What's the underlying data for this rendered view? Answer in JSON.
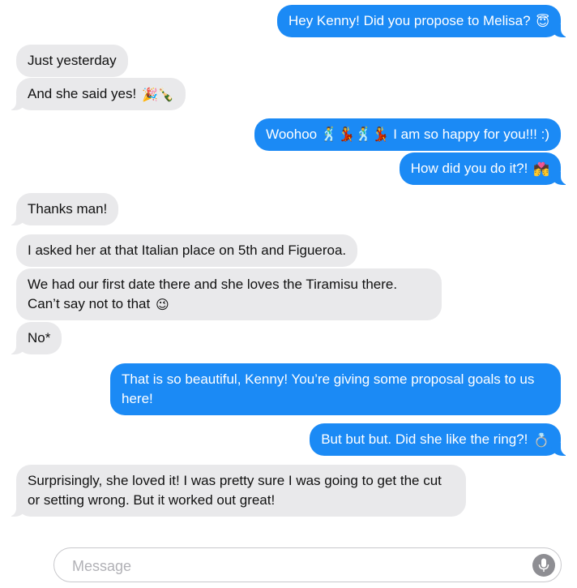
{
  "messages": [
    {
      "dir": "out",
      "text": "Hey Kenny! Did you propose to Melisa?",
      "emoji": "😇"
    },
    {
      "dir": "in",
      "text": "Just yesterday",
      "emoji": ""
    },
    {
      "dir": "in",
      "text": "And she said yes!",
      "emoji": "🎉🍾"
    },
    {
      "dir": "out",
      "text": "Woohoo 🕺💃🕺💃 I am so happy for you!!! :)",
      "emoji": ""
    },
    {
      "dir": "out",
      "text": "How did you do it?!",
      "emoji": "💏"
    },
    {
      "dir": "in",
      "text": "Thanks man!",
      "emoji": ""
    },
    {
      "dir": "in",
      "text": "I asked her at that Italian place on 5th and Figueroa.",
      "emoji": ""
    },
    {
      "dir": "in",
      "text": "We had our first date there and she loves the Tiramisu there. Can’t say not to that",
      "emoji": "😉"
    },
    {
      "dir": "in",
      "text": "No*",
      "emoji": ""
    },
    {
      "dir": "out",
      "text": "That is so beautiful, Kenny! You’re giving some proposal goals to us here!",
      "emoji": ""
    },
    {
      "dir": "out",
      "text": "But but but. Did she like the ring?!",
      "emoji": "💍"
    },
    {
      "dir": "in",
      "text": "Surprisingly, she loved it! I was pretty sure I was going to get the cut or setting wrong. But it worked out great!",
      "emoji": ""
    }
  ],
  "composer": {
    "placeholder": "Message",
    "mic_icon": "microphone-icon"
  },
  "colors": {
    "outgoing": "#1b8af5",
    "incoming": "#e9e9eb"
  }
}
